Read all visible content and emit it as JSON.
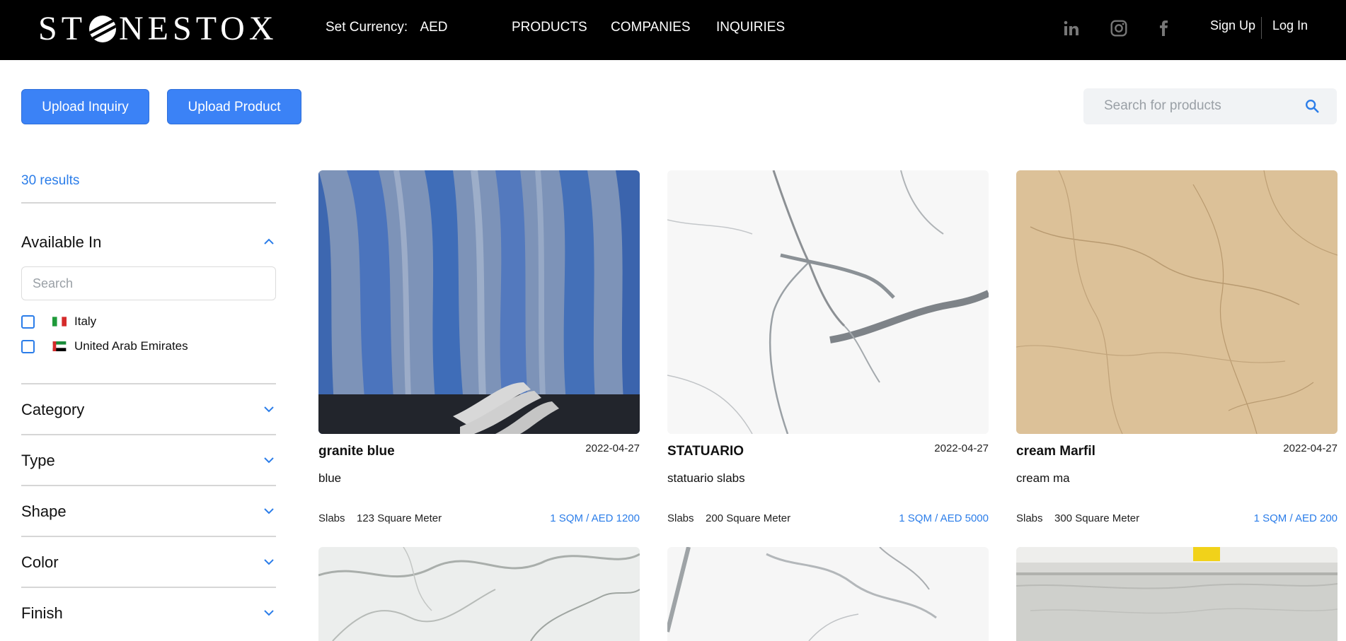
{
  "header": {
    "logo": "STONESTOX",
    "currency_label": "Set Currency:",
    "currency_value": "AED",
    "nav": [
      "PRODUCTS",
      "COMPANIES",
      "INQUIRIES"
    ],
    "social": [
      "linkedin-icon",
      "instagram-icon",
      "facebook-icon"
    ],
    "sign_up": "Sign Up",
    "log_in": "Log In"
  },
  "actions": {
    "upload_inquiry": "Upload Inquiry",
    "upload_product": "Upload Product"
  },
  "search": {
    "placeholder": "Search for products"
  },
  "filters": {
    "results": "30 results",
    "available_in": {
      "title": "Available In",
      "search_placeholder": "Search",
      "options": [
        "Italy",
        "United Arab Emirates"
      ]
    },
    "facets": [
      "Category",
      "Type",
      "Shape",
      "Color",
      "Finish"
    ]
  },
  "products": [
    {
      "title": "granite blue",
      "date": "2022-04-27",
      "desc": "blue",
      "kind": "Slabs",
      "qty": "123 Square Meter",
      "price": "1 SQM / AED 1200"
    },
    {
      "title": "STATUARIO",
      "date": "2022-04-27",
      "desc": "statuario slabs",
      "kind": "Slabs",
      "qty": "200 Square Meter",
      "price": "1 SQM / AED 5000"
    },
    {
      "title": "cream Marfil",
      "date": "2022-04-27",
      "desc": "cream ma",
      "kind": "Slabs",
      "qty": "300 Square Meter",
      "price": "1 SQM / AED 200"
    }
  ],
  "colors": {
    "accent": "#3b82f6",
    "link": "#2b7de9",
    "header_bg": "#000000"
  }
}
